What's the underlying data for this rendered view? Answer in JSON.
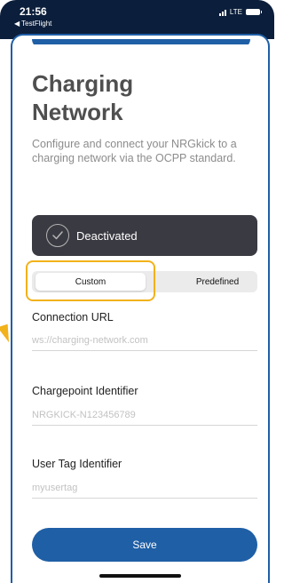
{
  "statusbar": {
    "time": "21:56",
    "back_app": "TestFlight",
    "network": "LTE"
  },
  "page": {
    "title": "Charging Network",
    "subtitle": "Configure and connect your NRGkick to a charging network via the OCPP standard."
  },
  "status_card": {
    "label": "Deactivated"
  },
  "mode_toggle": {
    "options": [
      "Custom",
      "Predefined"
    ],
    "selected": "Custom"
  },
  "fields": {
    "connection_url": {
      "label": "Connection URL",
      "placeholder": "ws://charging-network.com",
      "value": ""
    },
    "chargepoint_id": {
      "label": "Chargepoint Identifier",
      "placeholder": "NRGKICK-N123456789",
      "value": ""
    },
    "user_tag": {
      "label": "User Tag Identifier",
      "placeholder": "myusertag",
      "value": ""
    }
  },
  "save_button": {
    "label": "Save"
  },
  "colors": {
    "accent": "#1f5fa6",
    "highlight": "#f2b21b",
    "card": "#3a3a42",
    "statusbar": "#0b1e3b"
  }
}
